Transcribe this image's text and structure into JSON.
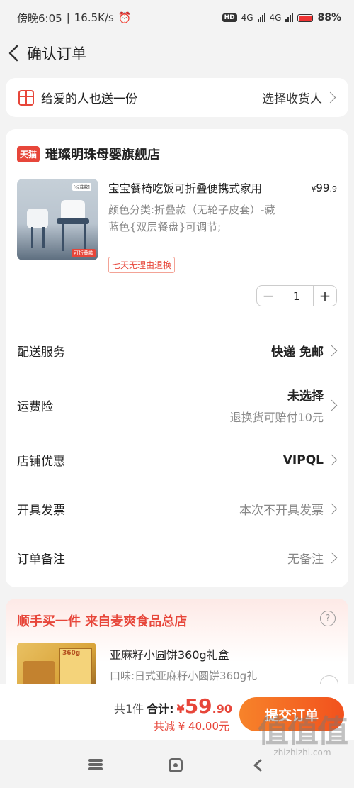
{
  "status_bar": {
    "time": "傍晚6:05",
    "speed": "16.5K/s",
    "net1": "4G",
    "net2": "4G",
    "battery_pct": "88%"
  },
  "header": {
    "title": "确认订单"
  },
  "gift": {
    "label": "给爱的人也送一份",
    "action": "选择收货人"
  },
  "shop": {
    "badge": "天猫",
    "name": "璀璨明珠母婴旗舰店"
  },
  "product": {
    "title": "宝宝餐椅吃饭可折叠便携式家用",
    "price_currency": "¥",
    "price_int": "99",
    "price_dec": ".9",
    "spec": "颜色分类:折叠款（无轮子皮套）-藏蓝色{双层餐盘}可调节;",
    "return_tag": "七天无理由退换",
    "image_tag": "可折叠款",
    "image_tag2": "[标准款]",
    "quantity": "1",
    "minus": "−",
    "plus": "+"
  },
  "options": {
    "delivery": {
      "label": "配送服务",
      "value": "快递 免邮"
    },
    "insurance": {
      "label": "运费险",
      "value": "未选择",
      "sub": "退换货可赔付10元"
    },
    "coupon": {
      "label": "店铺优惠",
      "value": "VIPQL"
    },
    "invoice": {
      "label": "开具发票",
      "value": "本次不开具发票"
    },
    "note": {
      "label": "订单备注",
      "value": "无备注"
    }
  },
  "upsell": {
    "title": "顺手买一件  来自麦爽食品总店",
    "help": "?",
    "item_name": "亚麻籽小圆饼360g礼盒",
    "item_spec": "口味:日式亚麻籽小圆饼360g礼",
    "image_label": "360g"
  },
  "bottom": {
    "count": "共1件",
    "total_label": "合计:",
    "currency": "¥",
    "total_int": "59",
    "total_dec": ".90",
    "saving": "共减 ¥ 40.00元",
    "submit": "提交订单"
  },
  "watermark": {
    "logo": "值值值",
    "text": "zhizhizhi.com"
  },
  "colors": {
    "accent": "#e7463a",
    "button_start": "#f7832a",
    "button_end": "#f2511d"
  }
}
